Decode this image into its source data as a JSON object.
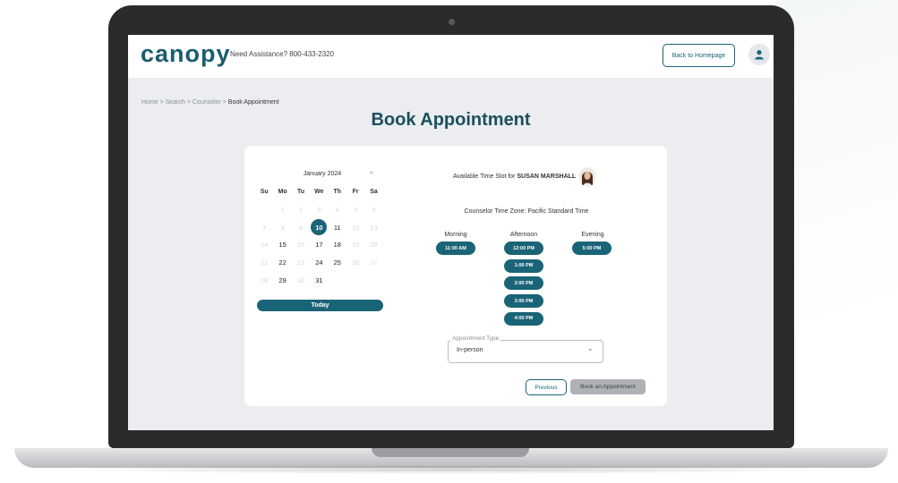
{
  "header": {
    "logo": "canopy",
    "assistance": "Need Assistance? 800-433-2320",
    "back_button": "Back to Homepage"
  },
  "breadcrumb": {
    "items": [
      "Home",
      "Search",
      "Counselor"
    ],
    "separator": ">",
    "current": "Book Appointment"
  },
  "page_title": "Book Appointment",
  "calendar": {
    "month_label": "January 2024",
    "nav_glyph": "«",
    "day_headers": [
      "Su",
      "Mo",
      "Tu",
      "We",
      "Th",
      "Fr",
      "Sa"
    ],
    "weeks": [
      [
        "",
        "1",
        "2",
        "3",
        "4",
        "5",
        "6"
      ],
      [
        "7",
        "8",
        "9",
        "10",
        "11",
        "12",
        "13"
      ],
      [
        "14",
        "15",
        "16",
        "17",
        "18",
        "19",
        "20"
      ],
      [
        "21",
        "22",
        "23",
        "24",
        "25",
        "26",
        "27"
      ],
      [
        "28",
        "29",
        "30",
        "31",
        "",
        "",
        ""
      ]
    ],
    "enabled_days": [
      "11",
      "15",
      "17",
      "18",
      "22",
      "24",
      "25",
      "29",
      "31"
    ],
    "selected_day": "10",
    "today_button": "Today"
  },
  "availability": {
    "prefix": "Available Time Slot for",
    "counselor_name": "SUSAN MARSHALL",
    "timezone_label": "Counselor Time Zone:",
    "timezone_value": "Pacific Standard Time"
  },
  "slots": {
    "morning_label": "Morning",
    "afternoon_label": "Afternoon",
    "evening_label": "Evening",
    "morning": [
      "11:00 AM"
    ],
    "afternoon": [
      "12:00 PM",
      "1:00 PM",
      "2:00 PM",
      "3:00 PM",
      "4:00 PM"
    ],
    "evening": [
      "5:00 PM"
    ]
  },
  "appointment_type": {
    "label": "Appointment Type",
    "value": "In-person"
  },
  "actions": {
    "previous": "Previous",
    "book": "Book an Appointment"
  },
  "colors": {
    "accent": "#1a6477",
    "title": "#1d4f5e",
    "disabled_button": "#aeb2b6",
    "screen_bg": "#ebedf0"
  }
}
